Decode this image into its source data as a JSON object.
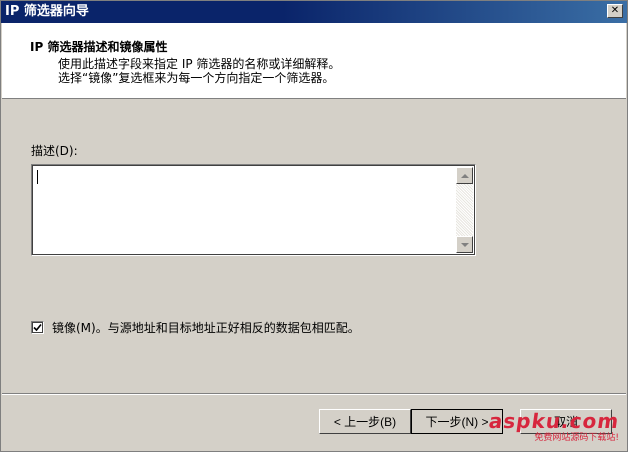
{
  "window": {
    "title": "IP 筛选器向导",
    "close_glyph": "✕"
  },
  "header": {
    "title": "IP 筛选器描述和镜像属性",
    "description_lines": [
      "使用此描述字段来指定 IP 筛选器的名称或详细解释。",
      "选择“镜像”复选框来为每一个方向指定一个筛选器。"
    ]
  },
  "description": {
    "label": "描述(D):",
    "value": ""
  },
  "mirror": {
    "checked": true,
    "label": "镜像(M)。与源地址和目标地址正好相反的数据包相匹配。"
  },
  "buttons": {
    "back_label": "< 上一步(B)",
    "next_label": "下一步(N) >",
    "cancel_label": "取消"
  },
  "watermark": {
    "text": "aspku.com",
    "subtext": "免费网站源码下载站!"
  },
  "colors": {
    "titlebar_start": "#0a246a",
    "titlebar_end": "#3a6ea5",
    "window_bg": "#d4d0c8",
    "header_bg": "#ffffff",
    "watermark": "#d7263d"
  }
}
